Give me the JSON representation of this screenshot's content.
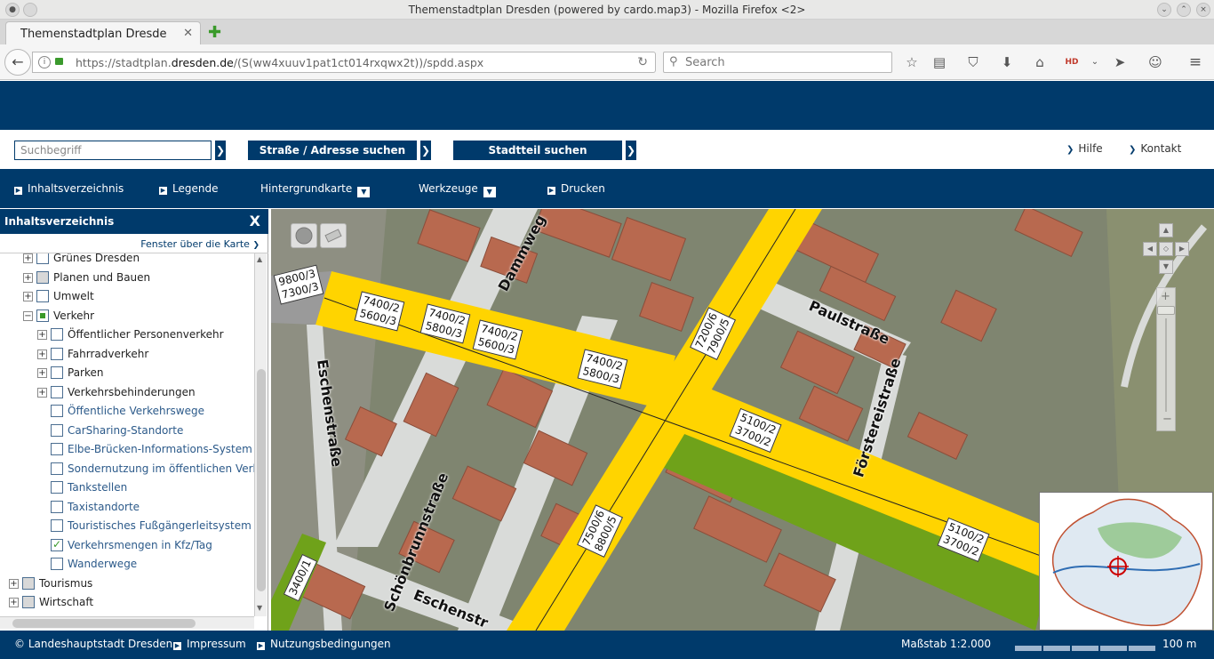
{
  "browser": {
    "window_title": "Themenstadtplan Dresden (powered by cardo.map3) - Mozilla Firefox <2>",
    "tab_title": "Themenstadtplan Dresde",
    "url_prefix": "https://stadtplan.",
    "url_domain": "dresden.de",
    "url_rest": "/(S(ww4xuuv1pat1ct014rxqwx2t))/spdd.aspx",
    "search_placeholder": "Search"
  },
  "search": {
    "term_placeholder": "Suchbegriff",
    "street_button": "Straße / Adresse suchen",
    "district_button": "Stadtteil suchen",
    "help_link": "Hilfe",
    "contact_link": "Kontakt"
  },
  "menu": {
    "toc": "Inhaltsverzeichnis",
    "legend": "Legende",
    "background_map": "Hintergrundkarte",
    "tools": "Werkzeuge",
    "print": "Drucken"
  },
  "sidebar": {
    "title": "Inhaltsverzeichnis",
    "close": "X",
    "window_over_map": "Fenster über die Karte",
    "tree": [
      {
        "label": "Grünes Dresden",
        "level": 1,
        "expand": "+",
        "state": "none"
      },
      {
        "label": "Planen und Bauen",
        "level": 1,
        "expand": "+",
        "state": "partial"
      },
      {
        "label": "Umwelt",
        "level": 1,
        "expand": "+",
        "state": "none"
      },
      {
        "label": "Verkehr",
        "level": 1,
        "expand": "−",
        "state": "filled"
      },
      {
        "label": "Öffentlicher Personenverkehr",
        "level": 2,
        "expand": "+",
        "state": "none"
      },
      {
        "label": "Fahrradverkehr",
        "level": 2,
        "expand": "+",
        "state": "none"
      },
      {
        "label": "Parken",
        "level": 2,
        "expand": "+",
        "state": "none"
      },
      {
        "label": "Verkehrsbehinderungen",
        "level": 2,
        "expand": "+",
        "state": "none"
      },
      {
        "label": "Öffentliche Verkehrswege",
        "level": 2,
        "expand": "",
        "state": "none"
      },
      {
        "label": "CarSharing-Standorte",
        "level": 2,
        "expand": "",
        "state": "none"
      },
      {
        "label": "Elbe-Brücken-Informations-System",
        "level": 2,
        "expand": "",
        "state": "none"
      },
      {
        "label": "Sondernutzung im öffentlichen Verkehrsraum",
        "level": 2,
        "expand": "",
        "state": "none"
      },
      {
        "label": "Tankstellen",
        "level": 2,
        "expand": "",
        "state": "none"
      },
      {
        "label": "Taxistandorte",
        "level": 2,
        "expand": "",
        "state": "none"
      },
      {
        "label": "Touristisches Fußgängerleitsystem",
        "level": 2,
        "expand": "",
        "state": "none"
      },
      {
        "label": "Verkehrsmengen in Kfz/Tag",
        "level": 2,
        "expand": "",
        "state": "checked"
      },
      {
        "label": "Wanderwege",
        "level": 2,
        "expand": "",
        "state": "none"
      },
      {
        "label": "Tourismus",
        "level": 0,
        "expand": "+",
        "state": "partial"
      },
      {
        "label": "Wirtschaft",
        "level": 0,
        "expand": "+",
        "state": "partial"
      }
    ]
  },
  "map": {
    "streets": {
      "dammweg": "Dammweg",
      "paulstrasse": "Paulstraße",
      "eschenstrasse": "Eschenstraße",
      "schoenbrunnstrasse": "Schönbrunnstraße",
      "foerstereistrasse": "Förstereistraße",
      "eschenstrasse_bottom": "Eschenstr"
    },
    "traffic_labels": {
      "a": [
        "9800/3",
        "7300/3"
      ],
      "b": [
        "7400/2",
        "5600/3"
      ],
      "c": [
        "7400/2",
        "5800/3"
      ],
      "d": [
        "7400/2",
        "5600/3"
      ],
      "e": [
        "7400/2",
        "5800/3"
      ],
      "f": [
        "7200/6",
        "7900/5"
      ],
      "g": [
        "5100/2",
        "3700/2"
      ],
      "h": [
        "7500/6",
        "8800/5"
      ],
      "i": [
        "5100/2",
        "3700/2"
      ],
      "j": [
        "3400/1"
      ]
    },
    "colors": {
      "yellow_road": "#ffd400",
      "green_road": "#6fa21a",
      "gray_road": "#9a9a9a"
    }
  },
  "footer": {
    "copyright": "© Landeshauptstadt Dresden",
    "imprint": "Impressum",
    "terms": "Nutzungsbedingungen",
    "scale": "Maßstab 1:2.000",
    "distance": "100 m"
  }
}
